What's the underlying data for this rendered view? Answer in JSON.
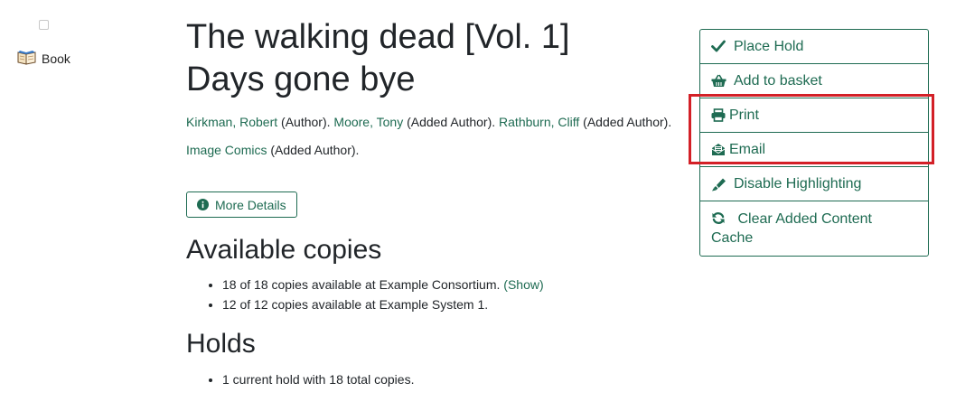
{
  "format": {
    "label": "Book",
    "icon": "book-icon"
  },
  "record": {
    "title_line1": "The walking dead [Vol. 1]",
    "title_line2": "Days gone bye",
    "authors": [
      {
        "name": "Kirkman, Robert",
        "role": "(Author)."
      },
      {
        "name": "Moore, Tony",
        "role": "(Added Author)."
      },
      {
        "name": "Rathburn, Cliff",
        "role": "(Added Author)."
      },
      {
        "name": "Image Comics",
        "role": "(Added Author)."
      }
    ],
    "more_details_label": "More Details"
  },
  "available": {
    "heading": "Available copies",
    "items": [
      {
        "text": "18 of 18 copies available at Example Consortium.",
        "link": "(Show)"
      },
      {
        "text": "12 of 12 copies available at Example System 1."
      }
    ]
  },
  "holds": {
    "heading": "Holds",
    "items": [
      "1 current hold with 18 total copies."
    ]
  },
  "actions": {
    "place_hold": "Place Hold",
    "add_to_basket": "Add to basket",
    "print": "Print",
    "email": "Email",
    "disable_highlighting": "Disable Highlighting",
    "clear_cache": "Clear Added Content Cache"
  },
  "colors": {
    "link": "#1e6b52",
    "highlight": "#d32027",
    "text": "#212529"
  }
}
